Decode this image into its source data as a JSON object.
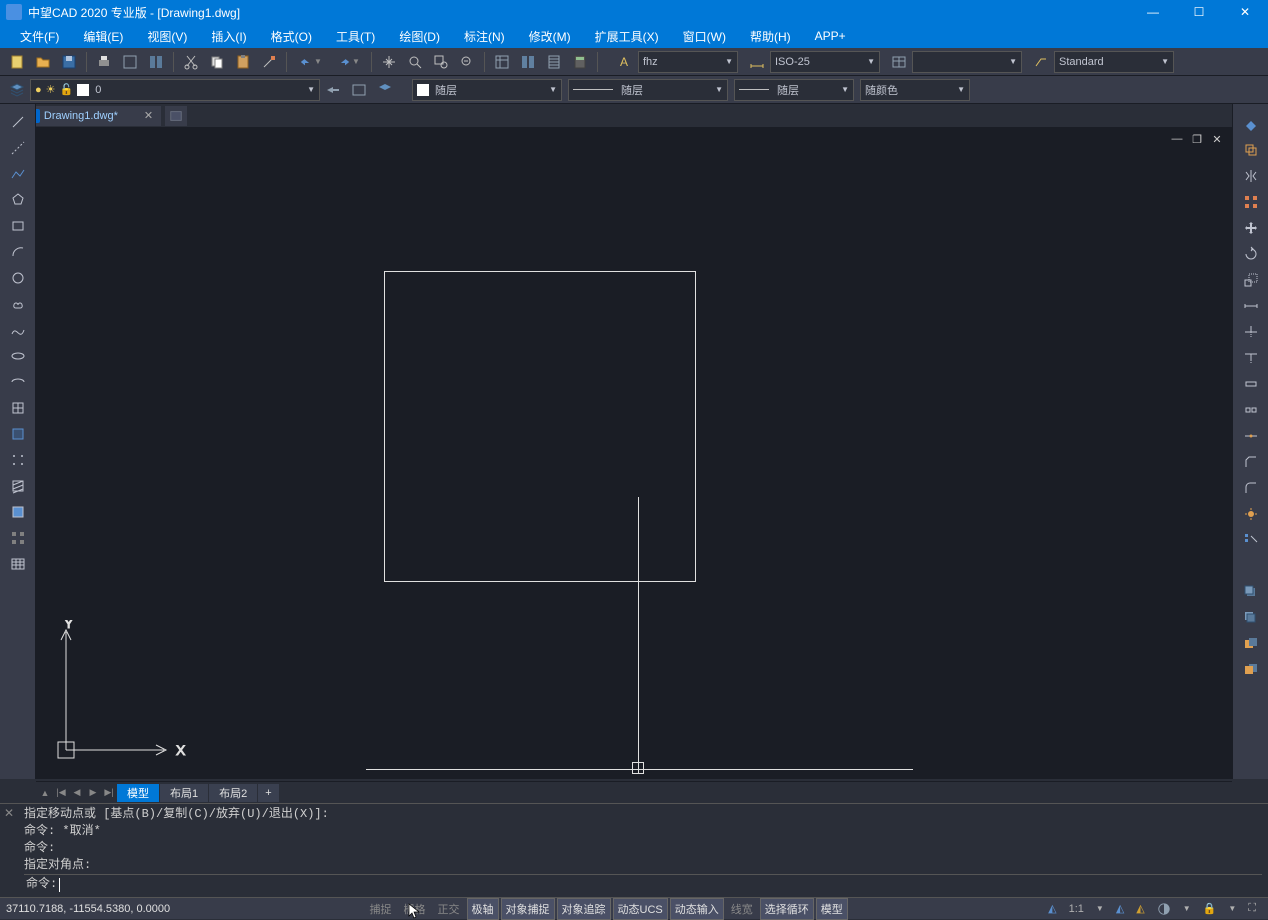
{
  "title": "中望CAD 2020 专业版 - [Drawing1.dwg]",
  "menus": [
    "文件(F)",
    "编辑(E)",
    "视图(V)",
    "插入(I)",
    "格式(O)",
    "工具(T)",
    "绘图(D)",
    "标注(N)",
    "修改(M)",
    "扩展工具(X)",
    "窗口(W)",
    "帮助(H)",
    "APP+"
  ],
  "textstyle": {
    "label": "fhz"
  },
  "dimstyle": {
    "label": "ISO-25"
  },
  "tablestyle": {
    "label": "Standard"
  },
  "layer": {
    "name": "0"
  },
  "linetype": {
    "label": "随层"
  },
  "lineweight": {
    "label": "随层"
  },
  "linecolor": {
    "label": "随层"
  },
  "plotcolor": {
    "label": "随颜色"
  },
  "doc": {
    "name": "Drawing1.dwg*"
  },
  "tabs": {
    "model": "模型",
    "layouts": [
      "布局1",
      "布局2"
    ]
  },
  "cmd": {
    "lines": [
      "指定移动点或 [基点(B)/复制(C)/放弃(U)/退出(X)]:",
      "命令: *取消*",
      "命令:",
      "指定对角点:"
    ],
    "prompt": "命令:"
  },
  "coords": "37110.7188, -11554.5380, 0.0000",
  "status_buttons": {
    "snap": "捕捉",
    "grid": "栅格",
    "ortho": "正交",
    "polar": "极轴",
    "osnap": "对象捕捉",
    "otrack": "对象追踪",
    "ducs": "动态UCS",
    "dyn": "动态输入",
    "lw": "线宽",
    "selcycle": "选择循环",
    "model": "模型"
  },
  "scale": "1:1",
  "icons": {
    "fullscreen": "⛶"
  }
}
